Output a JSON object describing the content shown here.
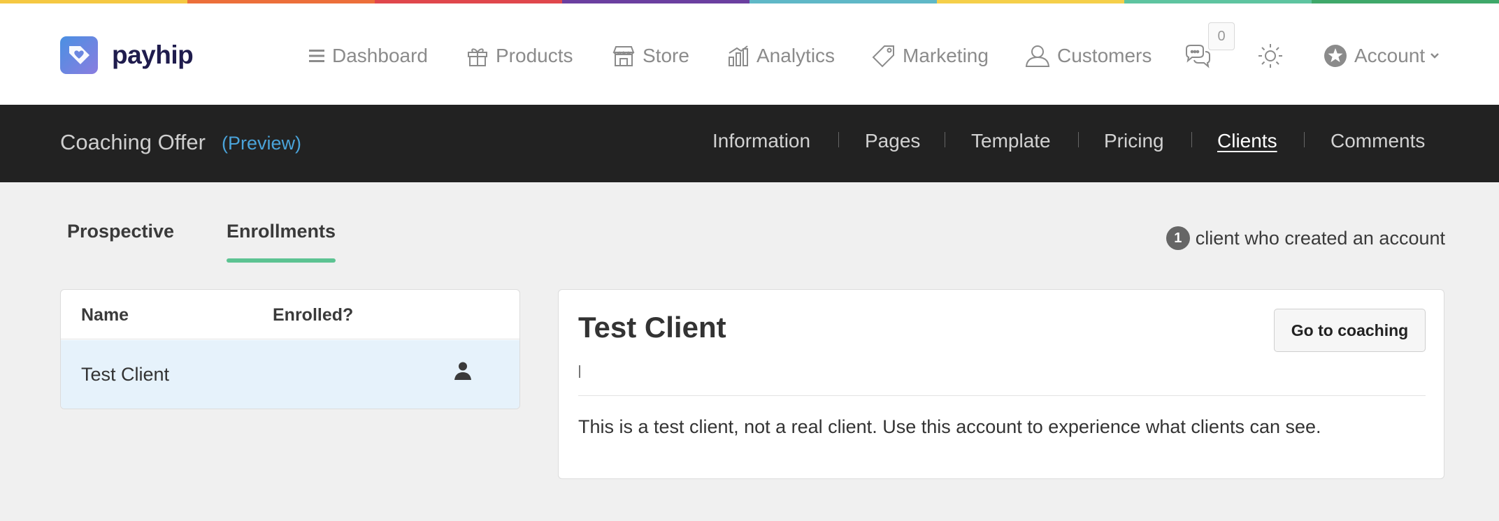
{
  "colors": {
    "rainbow": [
      "#f5c842",
      "#ec6f3a",
      "#e0474c",
      "#6b3fa0",
      "#5fb8c7",
      "#f5cf4a",
      "#5ec4a0",
      "#3fa86a"
    ],
    "accent_underline": "#5cc392",
    "preview_link": "#4aa3d9",
    "selected_row": "#e6f2fb"
  },
  "brand": {
    "name": "payhip"
  },
  "nav": {
    "items": [
      {
        "label": "Dashboard",
        "icon": "menu-icon"
      },
      {
        "label": "Products",
        "icon": "gift-icon"
      },
      {
        "label": "Store",
        "icon": "store-icon"
      },
      {
        "label": "Analytics",
        "icon": "chart-icon"
      },
      {
        "label": "Marketing",
        "icon": "tag-icon"
      },
      {
        "label": "Customers",
        "icon": "user-icon"
      }
    ],
    "chat_count": "0",
    "account_label": "Account"
  },
  "subnav": {
    "title": "Coaching Offer",
    "preview": "(Preview)",
    "tabs": [
      "Information",
      "Pages",
      "Template",
      "Pricing",
      "Clients",
      "Comments"
    ],
    "active_tab": "Clients"
  },
  "client_tabs": {
    "prospective": "Prospective",
    "enrollments": "Enrollments",
    "active": "Enrollments"
  },
  "client_count": {
    "count": "1",
    "text": "client who created an account"
  },
  "table": {
    "headers": [
      "Name",
      "Enrolled?"
    ],
    "rows": [
      {
        "name": "Test Client",
        "enrolled_icon": "person-icon"
      }
    ]
  },
  "detail": {
    "name": "Test Client",
    "button": "Go to coaching",
    "description": "This is a test client, not a real client. Use this account to experience what clients can see."
  }
}
